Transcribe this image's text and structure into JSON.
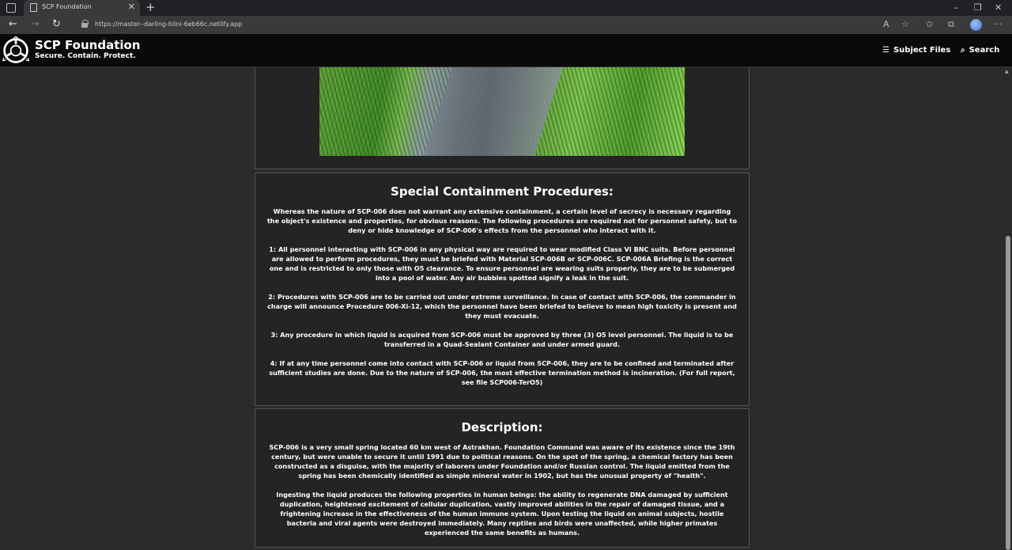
{
  "browser": {
    "tab_title": "SCP Foundation",
    "url": "https://master--darling-blini-6eb66c.netlify.app"
  },
  "site": {
    "title": "SCP Foundation",
    "tagline": "Secure. Contain. Protect.",
    "nav": {
      "subject_files": "Subject Files",
      "search": "Search"
    }
  },
  "containment": {
    "heading": "Special Containment Procedures:",
    "paragraphs": [
      "Whereas the nature of SCP-006 does not warrant any extensive containment, a certain level of secrecy is necessary regarding the object's existence and properties, for obvious reasons. The following procedures are required not for personnel safety, but to deny or hide knowledge of SCP-006's effects from the personnel who interact with it.",
      "1: All personnel interacting with SCP-006 in any physical way are required to wear modified Class VI BNC suits. Before personnel are allowed to perform procedures, they must be briefed with Material SCP-006B or SCP-006C. SCP-006A Briefing is the correct one and is restricted to only those with O5 clearance. To ensure personnel are wearing suits properly, they are to be submerged into a pool of water. Any air bubbles spotted signify a leak in the suit.",
      "2: Procedures with SCP-006 are to be carried out under extreme surveillance. In case of contact with SCP-006, the commander in charge will announce Procedure 006-Xi-12, which the personnel have been briefed to believe to mean high toxicity is present and they must evacuate.",
      "3: Any procedure in which liquid is acquired from SCP-006 must be approved by three (3) O5 level personnel. The liquid is to be transferred in a Quad-Sealant Container and under armed guard.",
      "4: If at any time personnel come into contact with SCP-006 or liquid from SCP-006, they are to be confined and terminated after sufficient studies are done. Due to the nature of SCP-006, the most effective termination method is incineration. (For full report, see file SCP006-TerO5)"
    ]
  },
  "description": {
    "heading": "Description:",
    "paragraphs": [
      "SCP-006 is a very small spring located 60 km west of Astrakhan. Foundation Command was aware of its existence since the 19th century, but were unable to secure it until 1991 due to political reasons. On the spot of the spring, a chemical factory has been constructed as a disguise, with the majority of laborers under Foundation and/or Russian control. The liquid emitted from the spring has been chemically identified as simple mineral water in 1902, but has the unusual property of \"health\".",
      "Ingesting the liquid produces the following properties in human beings: the ability to regenerate DNA damaged by sufficient duplication, heightened excitement of cellular duplication, vastly improved abilities in the repair of damaged tissue, and a frightening increase in the effectiveness of the human immune system. Upon testing the liquid on animal subjects, hostile bacteria and viral agents were destroyed immediately. Many reptiles and birds were unaffected, while higher primates experienced the same benefits as humans."
    ]
  }
}
